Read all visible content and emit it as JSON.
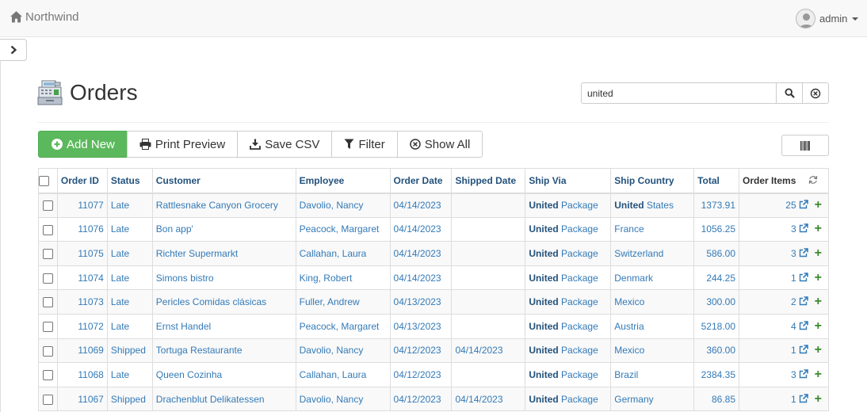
{
  "app": {
    "brand": "Northwind",
    "user": "admin"
  },
  "page": {
    "title": "Orders"
  },
  "search": {
    "value": "united"
  },
  "toolbar": {
    "add_new": "Add New",
    "print_preview": "Print Preview",
    "save_csv": "Save CSV",
    "filter": "Filter",
    "show_all": "Show All"
  },
  "table": {
    "columns": [
      "Order ID",
      "Status",
      "Customer",
      "Employee",
      "Order Date",
      "Shipped Date",
      "Ship Via",
      "Ship Country",
      "Total",
      "Order Items"
    ],
    "rows": [
      {
        "id": "11077",
        "status": "Late",
        "customer": "Rattlesnake Canyon Grocery",
        "employee": "Davolio, Nancy",
        "order_date": "04/14/2023",
        "shipped_date": "",
        "ship_via_hl": "United",
        "ship_via_rest": " Package",
        "country_hl": "United",
        "country_rest": " States",
        "total": "1373.91",
        "items": "25"
      },
      {
        "id": "11076",
        "status": "Late",
        "customer": "Bon app'",
        "employee": "Peacock, Margaret",
        "order_date": "04/14/2023",
        "shipped_date": "",
        "ship_via_hl": "United",
        "ship_via_rest": " Package",
        "country_hl": "",
        "country_rest": "France",
        "total": "1056.25",
        "items": "3"
      },
      {
        "id": "11075",
        "status": "Late",
        "customer": "Richter Supermarkt",
        "employee": "Callahan, Laura",
        "order_date": "04/14/2023",
        "shipped_date": "",
        "ship_via_hl": "United",
        "ship_via_rest": " Package",
        "country_hl": "",
        "country_rest": "Switzerland",
        "total": "586.00",
        "items": "3"
      },
      {
        "id": "11074",
        "status": "Late",
        "customer": "Simons bistro",
        "employee": "King, Robert",
        "order_date": "04/14/2023",
        "shipped_date": "",
        "ship_via_hl": "United",
        "ship_via_rest": " Package",
        "country_hl": "",
        "country_rest": "Denmark",
        "total": "244.25",
        "items": "1"
      },
      {
        "id": "11073",
        "status": "Late",
        "customer": "Pericles Comidas clásicas",
        "employee": "Fuller, Andrew",
        "order_date": "04/13/2023",
        "shipped_date": "",
        "ship_via_hl": "United",
        "ship_via_rest": " Package",
        "country_hl": "",
        "country_rest": "Mexico",
        "total": "300.00",
        "items": "2"
      },
      {
        "id": "11072",
        "status": "Late",
        "customer": "Ernst Handel",
        "employee": "Peacock, Margaret",
        "order_date": "04/13/2023",
        "shipped_date": "",
        "ship_via_hl": "United",
        "ship_via_rest": " Package",
        "country_hl": "",
        "country_rest": "Austria",
        "total": "5218.00",
        "items": "4"
      },
      {
        "id": "11069",
        "status": "Shipped",
        "customer": "Tortuga Restaurante",
        "employee": "Davolio, Nancy",
        "order_date": "04/12/2023",
        "shipped_date": "04/14/2023",
        "ship_via_hl": "United",
        "ship_via_rest": " Package",
        "country_hl": "",
        "country_rest": "Mexico",
        "total": "360.00",
        "items": "1"
      },
      {
        "id": "11068",
        "status": "Late",
        "customer": "Queen Cozinha",
        "employee": "Callahan, Laura",
        "order_date": "04/12/2023",
        "shipped_date": "",
        "ship_via_hl": "United",
        "ship_via_rest": " Package",
        "country_hl": "",
        "country_rest": "Brazil",
        "total": "2384.35",
        "items": "3"
      },
      {
        "id": "11067",
        "status": "Shipped",
        "customer": "Drachenblut Delikatessen",
        "employee": "Davolio, Nancy",
        "order_date": "04/12/2023",
        "shipped_date": "04/14/2023",
        "ship_via_hl": "United",
        "ship_via_rest": " Package",
        "country_hl": "",
        "country_rest": "Germany",
        "total": "86.85",
        "items": "1"
      }
    ]
  }
}
